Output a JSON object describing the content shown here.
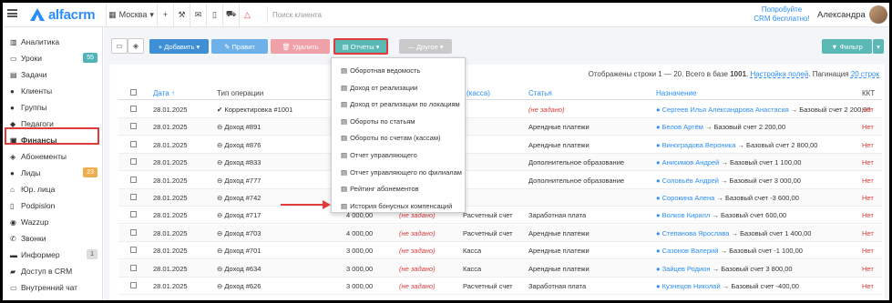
{
  "app": {
    "logo": "alfacrm"
  },
  "topbar": {
    "city": "Москва",
    "search_placeholder": "Поиск клиента",
    "promo": [
      "Попробуйте",
      "CRM бесплатно!"
    ],
    "user_name": "Александра"
  },
  "sidebar": {
    "items": [
      {
        "label": "Аналитика",
        "icon": "chart-icon"
      },
      {
        "label": "Уроки",
        "icon": "calendar-icon",
        "badge": "55"
      },
      {
        "label": "Задачи",
        "icon": "tasks-icon"
      },
      {
        "label": "Клиенты",
        "icon": "user-icon"
      },
      {
        "label": "Группы",
        "icon": "users-icon"
      },
      {
        "label": "Педагоги",
        "icon": "graduation-icon"
      },
      {
        "label": "Финансы",
        "icon": "money-icon"
      },
      {
        "label": "Абонементы",
        "icon": "tag-icon"
      },
      {
        "label": "Лиды",
        "icon": "user-plus-icon",
        "badge": "23"
      },
      {
        "label": "Юр. лица",
        "icon": "bank-icon"
      },
      {
        "label": "Podpislon",
        "icon": "document-icon"
      },
      {
        "label": "Wazzup",
        "icon": "whatsapp-icon"
      },
      {
        "label": "Звонки",
        "icon": "phone-icon"
      },
      {
        "label": "Информер",
        "icon": "inbox-icon",
        "badge": "1"
      },
      {
        "label": "Доступ в CRM",
        "icon": "lock-icon"
      },
      {
        "label": "Внутренний чат",
        "icon": "chat-icon"
      }
    ]
  },
  "toolbar": {
    "add": "+ Добавить ▾",
    "edit": "✎ Правит",
    "delete": "🗑 Удалить",
    "reports": "Отчеты ▾",
    "other": "— Другое ▾",
    "filter": "Фильтр"
  },
  "summary": {
    "text": "Отображены строки 1 — 20. Всего в базе",
    "total": "1001",
    "settings": "Настройка полей",
    "pagination_label": "Пагинация",
    "pagination_value": "20 строк"
  },
  "table": {
    "headers": {
      "date": "Дата ↑",
      "type": "Тип операции",
      "account": "(касса)",
      "article": "Статья",
      "purpose": "Назначение",
      "kkt": "ККТ"
    },
    "rows": [
      {
        "date": "28.01.2025",
        "type": "Корректировка #1001",
        "amount": "",
        "unset": "",
        "account": "",
        "article": "(не задано)",
        "client": "Сергеев Илья Александрова Анастасия",
        "target": "→ Базовый счет 2 200,00",
        "kkt": "Нет",
        "type_icon": "check-icon"
      },
      {
        "date": "28.01.2025",
        "type": "Доход #891",
        "amount": "",
        "unset": "",
        "account": "",
        "article": "Арендные платежи",
        "client": "Белов Артём",
        "target": "→ Базовый счет 2 200,00",
        "kkt": "Нет",
        "type_icon": "income-icon"
      },
      {
        "date": "28.01.2025",
        "type": "Доход #876",
        "amount": "",
        "unset": "",
        "account": "",
        "article": "Арендные платежи",
        "client": "Виноградова Вероника",
        "target": "→ Базовый счет 2 800,00",
        "kkt": "Нет",
        "type_icon": "income-icon"
      },
      {
        "date": "28.01.2025",
        "type": "Доход #833",
        "amount": "",
        "unset": "",
        "account": "",
        "article": "Дополнительное образование",
        "client": "Анисимов Андрей",
        "target": "→ Базовый счет 1 100,00",
        "kkt": "Нет",
        "type_icon": "income-icon"
      },
      {
        "date": "28.01.2025",
        "type": "Доход #777",
        "amount": "",
        "unset": "",
        "account": "",
        "article": "Дополнительное образование",
        "client": "Соловьёв Андрей",
        "target": "→ Базовый счет 3 000,00",
        "kkt": "Нет",
        "type_icon": "income-icon"
      },
      {
        "date": "28.01.2025",
        "type": "Доход #742",
        "amount": "",
        "unset": "",
        "account": "",
        "article": "",
        "client": "Сорокина Алена",
        "target": "→ Базовый счет -3 600,00",
        "kkt": "Нет",
        "type_icon": "income-icon"
      },
      {
        "date": "28.01.2025",
        "type": "Доход #717",
        "amount": "4 000,00",
        "unset": "(не задано)",
        "account": "Расчетный счет",
        "article": "Заработная плата",
        "client": "Волков Кирилл",
        "target": "→ Базовый счет 600,00",
        "kkt": "Нет",
        "type_icon": "income-icon"
      },
      {
        "date": "28.01.2025",
        "type": "Доход #703",
        "amount": "4 000,00",
        "unset": "(не задано)",
        "account": "Расчетный счет",
        "article": "Арендные платежи",
        "client": "Степанова Ярослава",
        "target": "→ Базовый счет 1 400,00",
        "kkt": "Нет",
        "type_icon": "income-icon"
      },
      {
        "date": "28.01.2025",
        "type": "Доход #701",
        "amount": "3 000,00",
        "unset": "(не задано)",
        "account": "Касса",
        "article": "Арендные платежи",
        "client": "Сазонов Валерий",
        "target": "→ Базовый счет -1 100,00",
        "kkt": "Нет",
        "type_icon": "income-icon"
      },
      {
        "date": "28.01.2025",
        "type": "Доход #634",
        "amount": "3 000,00",
        "unset": "(не задано)",
        "account": "Касса",
        "article": "Арендные платежи",
        "client": "Зайцев Родион",
        "target": "→ Базовый счет 3 800,00",
        "kkt": "Нет",
        "type_icon": "income-icon"
      },
      {
        "date": "28.01.2025",
        "type": "Доход #626",
        "amount": "3 000,00",
        "unset": "(не задано)",
        "account": "Расчетный счет",
        "article": "Заработная плата",
        "client": "Кузнецов Николай",
        "target": "→ Базовый счет -400,00",
        "kkt": "Нет",
        "type_icon": "income-icon"
      }
    ]
  },
  "reports_menu": {
    "items": [
      "Оборотная ведомость",
      "Доход от реализации",
      "Доход от реализации по локациям",
      "Обороты по статьям",
      "Обороты по счетам (кассам)",
      "Отчет управляющего",
      "Отчет управляющего по филиалам",
      "Рейтинг абонементов",
      "История бонусных компенсаций"
    ]
  },
  "colors": {
    "accent": "#2c8ef8",
    "teal": "#5ab9b4",
    "highlight": "#e03b3b"
  }
}
